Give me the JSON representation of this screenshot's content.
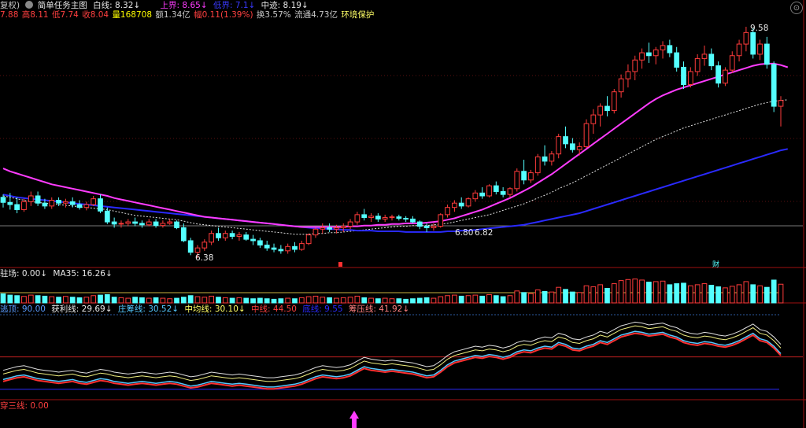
{
  "header": {
    "adjust_label": "复权)",
    "formula_icon": "gear-icon",
    "formula_name": "简单任务主图",
    "white_line": "白线: 8.32↓",
    "upper": "上界: 8.65↓",
    "lower": "低界: 7.1↓",
    "middle": "中迹: 8.19↓"
  },
  "quote": {
    "open": "7.88",
    "high": "高8.11",
    "low": "低7.74",
    "close": "收8.04",
    "volume": "量168708",
    "amount": "额1.34亿",
    "change": "幅0.11(1.39%)",
    "turnover": "换3.57%",
    "float": "流通4.73亿",
    "env": "环境保护"
  },
  "price_labels": {
    "high_label": "9.58",
    "low_label": "6.38",
    "mid_label": "6.80",
    "mid_label2": "6.82",
    "event_marker": "财"
  },
  "panel2": {
    "label1": "驻场: 0.00↓",
    "label2": "MA35: 16.26↓"
  },
  "panel3": {
    "l1": "逃顶: 90.00",
    "l2": "获利线: 29.69↓",
    "l3": "庄筹线: 30.52↓",
    "l4": "中均线: 30.10↓",
    "l5": "中线: 44.50",
    "l6": "底线: 9.55",
    "l7": "筹压线: 41.92↓"
  },
  "panel4": {
    "label": "穿三线: 0.00"
  },
  "colors": {
    "up": "#ff3b3b",
    "down": "#54ffff",
    "magenta": "#ff3cff",
    "blue": "#2a2aff",
    "white": "#e0e0e0",
    "yellow": "#ffff00",
    "green": "#00d000",
    "panel_border": "#a01010"
  },
  "chart_data": {
    "type": "candlestick",
    "candles": [
      [
        7.22,
        7.26,
        7.08,
        7.15
      ],
      [
        7.15,
        7.28,
        7.05,
        7.12
      ],
      [
        7.12,
        7.22,
        7.0,
        7.05
      ],
      [
        7.05,
        7.2,
        7.02,
        7.16
      ],
      [
        7.16,
        7.3,
        7.1,
        7.24
      ],
      [
        7.24,
        7.3,
        7.1,
        7.14
      ],
      [
        7.14,
        7.2,
        7.06,
        7.1
      ],
      [
        7.1,
        7.22,
        7.06,
        7.18
      ],
      [
        7.18,
        7.22,
        7.1,
        7.14
      ],
      [
        7.14,
        7.2,
        7.08,
        7.16
      ],
      [
        7.16,
        7.22,
        7.08,
        7.12
      ],
      [
        7.12,
        7.18,
        7.05,
        7.08
      ],
      [
        7.08,
        7.16,
        7.04,
        7.12
      ],
      [
        7.12,
        7.24,
        7.1,
        7.2
      ],
      [
        7.2,
        7.26,
        7.0,
        7.03
      ],
      [
        7.03,
        7.08,
        6.85,
        6.88
      ],
      [
        6.88,
        6.94,
        6.8,
        6.85
      ],
      [
        6.85,
        6.9,
        6.8,
        6.86
      ],
      [
        6.86,
        6.92,
        6.82,
        6.88
      ],
      [
        6.88,
        6.94,
        6.82,
        6.86
      ],
      [
        6.86,
        6.9,
        6.8,
        6.84
      ],
      [
        6.84,
        6.92,
        6.82,
        6.88
      ],
      [
        6.88,
        6.92,
        6.8,
        6.83
      ],
      [
        6.83,
        6.9,
        6.8,
        6.86
      ],
      [
        6.86,
        6.92,
        6.84,
        6.88
      ],
      [
        6.88,
        6.9,
        6.78,
        6.8
      ],
      [
        6.8,
        6.86,
        6.6,
        6.62
      ],
      [
        6.62,
        6.66,
        6.42,
        6.46
      ],
      [
        6.46,
        6.56,
        6.38,
        6.52
      ],
      [
        6.52,
        6.64,
        6.48,
        6.6
      ],
      [
        6.6,
        6.76,
        6.56,
        6.72
      ],
      [
        6.72,
        6.8,
        6.62,
        6.66
      ],
      [
        6.66,
        6.76,
        6.62,
        6.72
      ],
      [
        6.72,
        6.76,
        6.64,
        6.68
      ],
      [
        6.68,
        6.74,
        6.62,
        6.7
      ],
      [
        6.7,
        6.74,
        6.62,
        6.64
      ],
      [
        6.64,
        6.7,
        6.56,
        6.62
      ],
      [
        6.62,
        6.66,
        6.52,
        6.56
      ],
      [
        6.56,
        6.62,
        6.48,
        6.52
      ],
      [
        6.52,
        6.58,
        6.46,
        6.5
      ],
      [
        6.5,
        6.56,
        6.44,
        6.48
      ],
      [
        6.48,
        6.58,
        6.44,
        6.54
      ],
      [
        6.54,
        6.6,
        6.46,
        6.5
      ],
      [
        6.5,
        6.62,
        6.48,
        6.58
      ],
      [
        6.58,
        6.72,
        6.56,
        6.7
      ],
      [
        6.7,
        6.8,
        6.66,
        6.78
      ],
      [
        6.78,
        6.86,
        6.72,
        6.8
      ],
      [
        6.8,
        6.86,
        6.74,
        6.78
      ],
      [
        6.78,
        6.84,
        6.72,
        6.8
      ],
      [
        6.8,
        6.86,
        6.74,
        6.82
      ],
      [
        6.82,
        6.92,
        6.78,
        6.88
      ],
      [
        6.88,
        7.02,
        6.84,
        6.98
      ],
      [
        6.98,
        7.06,
        6.9,
        6.94
      ],
      [
        6.94,
        7.0,
        6.88,
        6.96
      ],
      [
        6.96,
        7.0,
        6.88,
        6.92
      ],
      [
        6.92,
        6.98,
        6.88,
        6.94
      ],
      [
        6.94,
        6.98,
        6.9,
        6.95
      ],
      [
        6.95,
        6.98,
        6.9,
        6.93
      ],
      [
        6.93,
        6.96,
        6.88,
        6.92
      ],
      [
        6.92,
        6.96,
        6.86,
        6.88
      ],
      [
        6.88,
        6.9,
        6.78,
        6.82
      ],
      [
        6.82,
        6.86,
        6.74,
        6.8
      ],
      [
        6.8,
        6.86,
        6.76,
        6.82
      ],
      [
        6.82,
        7.0,
        6.8,
        6.98
      ],
      [
        6.98,
        7.12,
        6.94,
        7.08
      ],
      [
        7.08,
        7.18,
        7.02,
        7.14
      ],
      [
        7.14,
        7.22,
        7.06,
        7.1
      ],
      [
        7.1,
        7.22,
        7.08,
        7.2
      ],
      [
        7.2,
        7.32,
        7.16,
        7.28
      ],
      [
        7.28,
        7.36,
        7.2,
        7.24
      ],
      [
        7.24,
        7.4,
        7.22,
        7.38
      ],
      [
        7.38,
        7.44,
        7.26,
        7.3
      ],
      [
        7.3,
        7.36,
        7.22,
        7.26
      ],
      [
        7.26,
        7.36,
        7.22,
        7.34
      ],
      [
        7.34,
        7.62,
        7.3,
        7.58
      ],
      [
        7.58,
        7.74,
        7.4,
        7.46
      ],
      [
        7.46,
        7.6,
        7.42,
        7.56
      ],
      [
        7.56,
        7.82,
        7.52,
        7.78
      ],
      [
        7.78,
        7.94,
        7.66,
        7.72
      ],
      [
        7.72,
        7.86,
        7.66,
        7.82
      ],
      [
        7.82,
        8.1,
        7.76,
        8.06
      ],
      [
        8.06,
        8.2,
        7.9,
        7.96
      ],
      [
        7.96,
        8.04,
        7.84,
        7.88
      ],
      [
        7.88,
        7.98,
        7.8,
        7.92
      ],
      [
        7.92,
        8.3,
        7.9,
        8.24
      ],
      [
        8.24,
        8.44,
        8.1,
        8.36
      ],
      [
        8.36,
        8.52,
        8.2,
        8.48
      ],
      [
        8.48,
        8.62,
        8.34,
        8.42
      ],
      [
        8.42,
        8.72,
        8.38,
        8.68
      ],
      [
        8.68,
        8.92,
        8.6,
        8.86
      ],
      [
        8.86,
        9.06,
        8.74,
        8.96
      ],
      [
        8.96,
        9.18,
        8.84,
        9.12
      ],
      [
        9.12,
        9.28,
        9.0,
        9.22
      ],
      [
        9.22,
        9.36,
        9.08,
        9.18
      ],
      [
        9.18,
        9.3,
        9.06,
        9.26
      ],
      [
        9.26,
        9.38,
        9.14,
        9.32
      ],
      [
        9.32,
        9.4,
        9.16,
        9.22
      ],
      [
        9.22,
        9.3,
        8.96,
        9.02
      ],
      [
        9.02,
        9.1,
        8.72,
        8.78
      ],
      [
        8.78,
        9.02,
        8.74,
        8.96
      ],
      [
        8.96,
        9.2,
        8.9,
        9.14
      ],
      [
        9.14,
        9.32,
        9.04,
        9.2
      ],
      [
        9.2,
        9.28,
        8.98,
        9.04
      ],
      [
        9.04,
        9.1,
        8.74,
        8.8
      ],
      [
        8.8,
        9.02,
        8.76,
        8.98
      ],
      [
        8.98,
        9.24,
        8.94,
        9.18
      ],
      [
        9.18,
        9.4,
        9.1,
        9.34
      ],
      [
        9.34,
        9.58,
        9.24,
        9.5
      ],
      [
        9.5,
        9.56,
        9.14,
        9.2
      ],
      [
        9.2,
        9.4,
        9.12,
        9.34
      ],
      [
        9.34,
        9.44,
        9.0,
        9.06
      ],
      [
        9.06,
        9.1,
        8.4,
        8.48
      ],
      [
        8.48,
        8.62,
        8.2,
        8.56
      ]
    ],
    "ma_white": [
      7.24,
      7.22,
      7.2,
      7.18,
      7.16,
      7.15,
      7.14,
      7.13,
      7.12,
      7.11,
      7.1,
      7.09,
      7.08,
      7.07,
      7.06,
      7.05,
      7.03,
      7.01,
      6.99,
      6.97,
      6.96,
      6.95,
      6.94,
      6.93,
      6.92,
      6.91,
      6.89,
      6.87,
      6.85,
      6.84,
      6.83,
      6.82,
      6.81,
      6.8,
      6.79,
      6.78,
      6.77,
      6.76,
      6.75,
      6.74,
      6.73,
      6.72,
      6.71,
      6.71,
      6.71,
      6.72,
      6.72,
      6.73,
      6.73,
      6.74,
      6.75,
      6.76,
      6.77,
      6.78,
      6.79,
      6.8,
      6.81,
      6.82,
      6.82,
      6.83,
      6.83,
      6.83,
      6.84,
      6.85,
      6.86,
      6.88,
      6.9,
      6.92,
      6.94,
      6.96,
      6.98,
      7.01,
      7.04,
      7.07,
      7.1,
      7.13,
      7.17,
      7.21,
      7.25,
      7.29,
      7.34,
      7.38,
      7.42,
      7.47,
      7.52,
      7.57,
      7.62,
      7.67,
      7.72,
      7.77,
      7.82,
      7.87,
      7.92,
      7.97,
      8.02,
      8.06,
      8.1,
      8.14,
      8.18,
      8.21,
      8.24,
      8.27,
      8.3,
      8.33,
      8.36,
      8.39,
      8.42,
      8.45,
      8.48,
      8.51,
      8.53,
      8.55,
      8.56,
      8.57
    ],
    "ma_magenta": [
      7.62,
      7.58,
      7.55,
      7.52,
      7.49,
      7.46,
      7.43,
      7.4,
      7.38,
      7.36,
      7.34,
      7.32,
      7.3,
      7.28,
      7.26,
      7.24,
      7.21,
      7.19,
      7.17,
      7.15,
      7.13,
      7.11,
      7.09,
      7.07,
      7.05,
      7.03,
      7.01,
      6.99,
      6.97,
      6.95,
      6.94,
      6.93,
      6.92,
      6.91,
      6.9,
      6.89,
      6.88,
      6.87,
      6.86,
      6.85,
      6.84,
      6.83,
      6.82,
      6.81,
      6.81,
      6.81,
      6.81,
      6.81,
      6.81,
      6.81,
      6.82,
      6.82,
      6.83,
      6.83,
      6.84,
      6.84,
      6.85,
      6.85,
      6.86,
      6.86,
      6.86,
      6.87,
      6.88,
      6.89,
      6.91,
      6.93,
      6.96,
      6.99,
      7.02,
      7.05,
      7.09,
      7.13,
      7.17,
      7.21,
      7.26,
      7.31,
      7.36,
      7.42,
      7.48,
      7.54,
      7.61,
      7.68,
      7.75,
      7.82,
      7.89,
      7.96,
      8.03,
      8.1,
      8.17,
      8.24,
      8.31,
      8.38,
      8.45,
      8.52,
      8.58,
      8.63,
      8.67,
      8.71,
      8.74,
      8.77,
      8.8,
      8.83,
      8.86,
      8.89,
      8.92,
      8.95,
      8.98,
      9.01,
      9.04,
      9.06,
      9.07,
      9.07,
      9.05,
      9.02
    ],
    "ma_blue": [
      7.26,
      7.24,
      7.22,
      7.21,
      7.2,
      7.19,
      7.18,
      7.17,
      7.16,
      7.15,
      7.14,
      7.13,
      7.12,
      7.11,
      7.1,
      7.09,
      7.08,
      7.07,
      7.06,
      7.05,
      7.04,
      7.03,
      7.02,
      7.01,
      7.0,
      6.99,
      6.98,
      6.97,
      6.96,
      6.95,
      6.94,
      6.93,
      6.92,
      6.91,
      6.9,
      6.89,
      6.88,
      6.87,
      6.86,
      6.85,
      6.84,
      6.83,
      6.82,
      6.81,
      6.8,
      6.79,
      6.79,
      6.78,
      6.78,
      6.77,
      6.77,
      6.76,
      6.76,
      6.76,
      6.75,
      6.75,
      6.75,
      6.75,
      6.74,
      6.74,
      6.74,
      6.74,
      6.74,
      6.74,
      6.75,
      6.75,
      6.76,
      6.76,
      6.77,
      6.78,
      6.79,
      6.8,
      6.81,
      6.82,
      6.83,
      6.84,
      6.86,
      6.88,
      6.9,
      6.92,
      6.94,
      6.96,
      6.98,
      7.0,
      7.03,
      7.06,
      7.09,
      7.12,
      7.15,
      7.18,
      7.21,
      7.24,
      7.27,
      7.3,
      7.33,
      7.36,
      7.39,
      7.42,
      7.45,
      7.48,
      7.51,
      7.54,
      7.57,
      7.6,
      7.63,
      7.66,
      7.69,
      7.72,
      7.75,
      7.78,
      7.81,
      7.84,
      7.87,
      7.89
    ],
    "volume": [
      0.35,
      0.3,
      0.28,
      0.25,
      0.3,
      0.28,
      0.26,
      0.24,
      0.22,
      0.25,
      0.22,
      0.2,
      0.22,
      0.28,
      0.3,
      0.32,
      0.22,
      0.2,
      0.18,
      0.22,
      0.2,
      0.18,
      0.2,
      0.18,
      0.16,
      0.18,
      0.22,
      0.28,
      0.24,
      0.22,
      0.26,
      0.22,
      0.2,
      0.18,
      0.2,
      0.18,
      0.16,
      0.18,
      0.16,
      0.14,
      0.16,
      0.18,
      0.16,
      0.2,
      0.24,
      0.26,
      0.22,
      0.2,
      0.18,
      0.2,
      0.22,
      0.26,
      0.2,
      0.18,
      0.16,
      0.18,
      0.16,
      0.16,
      0.14,
      0.16,
      0.18,
      0.2,
      0.18,
      0.24,
      0.28,
      0.3,
      0.26,
      0.28,
      0.3,
      0.26,
      0.32,
      0.28,
      0.24,
      0.28,
      0.46,
      0.4,
      0.36,
      0.5,
      0.44,
      0.42,
      0.6,
      0.52,
      0.42,
      0.4,
      0.66,
      0.62,
      0.7,
      0.56,
      0.74,
      0.86,
      0.9,
      0.92,
      0.88,
      0.8,
      0.82,
      0.84,
      0.7,
      0.74,
      0.76,
      0.66,
      0.7,
      0.74,
      0.68,
      0.62,
      0.58,
      0.64,
      0.7,
      0.82,
      0.7,
      0.66,
      0.6,
      0.88,
      0.72
    ],
    "osc_white": [
      30,
      32,
      34,
      35,
      33,
      31,
      30,
      29,
      28,
      29,
      30,
      28,
      27,
      29,
      31,
      30,
      28,
      27,
      26,
      27,
      28,
      27,
      26,
      27,
      28,
      27,
      25,
      23,
      24,
      26,
      28,
      27,
      26,
      25,
      26,
      25,
      24,
      23,
      22,
      22,
      23,
      24,
      25,
      27,
      30,
      33,
      35,
      34,
      33,
      34,
      36,
      40,
      44,
      42,
      41,
      40,
      41,
      40,
      39,
      38,
      36,
      34,
      35,
      40,
      46,
      50,
      52,
      54,
      56,
      55,
      57,
      56,
      54,
      56,
      60,
      62,
      61,
      64,
      66,
      65,
      70,
      68,
      64,
      63,
      66,
      68,
      72,
      70,
      74,
      78,
      80,
      82,
      81,
      79,
      80,
      81,
      78,
      76,
      72,
      70,
      69,
      71,
      70,
      68,
      67,
      69,
      72,
      76,
      80,
      74,
      72,
      66,
      58
    ]
  }
}
